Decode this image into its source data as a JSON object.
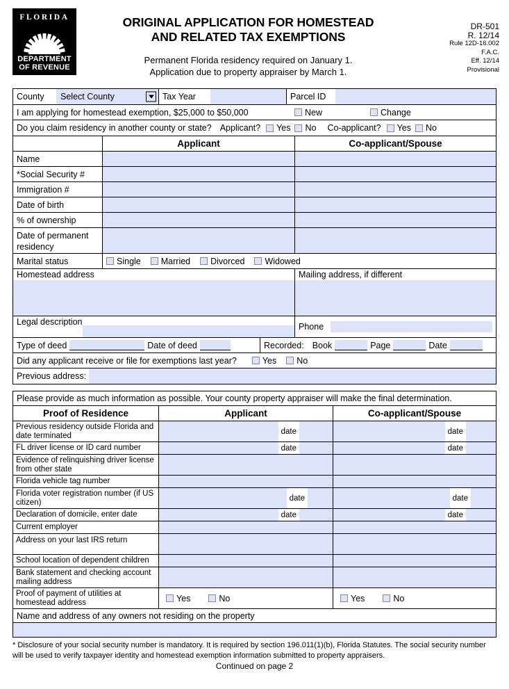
{
  "header": {
    "logo": {
      "top_text": "FLORIDA",
      "bottom_line1": "DEPARTMENT",
      "bottom_line2": "OF REVENUE"
    },
    "title_line1": "ORIGINAL APPLICATION FOR HOMESTEAD",
    "title_line2": "AND RELATED TAX EXEMPTIONS",
    "subtitle_line1": "Permanent Florida residency required on January 1.",
    "subtitle_line2": "Application due to property appraiser by March 1.",
    "form_number": "DR-501",
    "revision": "R. 12/14",
    "rule": "Rule 12D-16.002",
    "fac": "F.A.C.",
    "effective": "Eff. 12/14",
    "provisional": "Provisional"
  },
  "top": {
    "county_label": "County",
    "county_value": "Select County",
    "tax_year_label": "Tax Year",
    "tax_year_value": "",
    "parcel_id_label": "Parcel ID",
    "parcel_id_value": "",
    "exemption_text": "I am applying for homestead exemption, $25,000 to $50,000",
    "new_label": "New",
    "change_label": "Change",
    "residency_question": "Do you claim residency in another county or state?",
    "applicant_label": "Applicant?",
    "coapplicant_label": "Co-applicant?",
    "yes_label": "Yes",
    "no_label": "No"
  },
  "applicant_table": {
    "col_applicant": "Applicant",
    "col_coapplicant": "Co-applicant/Spouse",
    "rows": [
      {
        "label": "Name",
        "applicant": "",
        "coapplicant": ""
      },
      {
        "label": "*Social Security #",
        "applicant": "",
        "coapplicant": ""
      },
      {
        "label": "Immigration #",
        "applicant": "",
        "coapplicant": ""
      },
      {
        "label": "Date of birth",
        "applicant": "",
        "coapplicant": ""
      },
      {
        "label": "% of ownership",
        "applicant": "",
        "coapplicant": ""
      },
      {
        "label": "Date of permanent residency",
        "applicant": "",
        "coapplicant": ""
      }
    ],
    "marital_label": "Marital status",
    "marital_options": [
      "Single",
      "Married",
      "Divorced",
      "Widowed"
    ]
  },
  "address": {
    "homestead_label": "Homestead address",
    "homestead_value": "",
    "mailing_label": "Mailing address, if different",
    "mailing_value": "",
    "legal_label": "Legal description",
    "legal_value": "",
    "phone_label": "Phone",
    "phone_value": "",
    "type_of_deed_label": "Type of deed",
    "type_of_deed_value": "",
    "date_of_deed_label": "Date of deed",
    "date_of_deed_value": "",
    "recorded_label": "Recorded:",
    "book_label": "Book",
    "book_value": "",
    "page_label": "Page",
    "page_value": "",
    "date_label": "Date",
    "date_value": "",
    "exemptions_question": "Did any applicant receive or file for exemptions last year?",
    "yes_label": "Yes",
    "no_label": "No",
    "previous_address_label": "Previous address:",
    "previous_address_value": ""
  },
  "proof": {
    "note": "Please provide as much information as possible. Your county property appraiser will make the final determination.",
    "col_title": "Proof of Residence",
    "col_applicant": "Applicant",
    "col_coapplicant": "Co-applicant/Spouse",
    "date_label": "date",
    "yes_label": "Yes",
    "no_label": "No",
    "rows": [
      {
        "label": "Previous residency outside Florida and date terminated",
        "kind": "date",
        "applicant": "",
        "coapplicant": "",
        "applicant_date": "",
        "coapplicant_date": ""
      },
      {
        "label": "FL driver license or ID card number",
        "kind": "date",
        "applicant": "",
        "coapplicant": "",
        "applicant_date": "",
        "coapplicant_date": ""
      },
      {
        "label": "Evidence of relinquishing driver license from other state",
        "kind": "plain",
        "applicant": "",
        "coapplicant": ""
      },
      {
        "label": "Florida vehicle tag number",
        "kind": "plain",
        "applicant": "",
        "coapplicant": ""
      },
      {
        "label": "Florida voter registration number (if US citizen)",
        "kind": "date",
        "applicant": "",
        "coapplicant": "",
        "applicant_date": "",
        "coapplicant_date": ""
      },
      {
        "label": "Declaration of domicile, enter date",
        "kind": "date",
        "applicant": "",
        "coapplicant": "",
        "applicant_date": "",
        "coapplicant_date": ""
      },
      {
        "label": "Current employer",
        "kind": "plain",
        "applicant": "",
        "coapplicant": ""
      },
      {
        "label": "Address on your last IRS return",
        "kind": "plain",
        "applicant": "",
        "coapplicant": ""
      },
      {
        "label": "School location of dependent children",
        "kind": "plain",
        "applicant": "",
        "coapplicant": ""
      },
      {
        "label": "Bank statement and checking account mailing address",
        "kind": "plain",
        "applicant": "",
        "coapplicant": ""
      },
      {
        "label": "Proof of payment of utilities at homestead address",
        "kind": "yesno",
        "applicant": "",
        "coapplicant": ""
      }
    ],
    "owners_label": "Name and address of any owners not residing on the property",
    "owners_value": ""
  },
  "footer": {
    "disclosure": "* Disclosure of your social security number is mandatory. It is required by section 196.011(1)(b), Florida Statutes. The social security number will be used to verify taxpayer identity and homestead exemption information submitted to property appraisers.",
    "continued": "Continued on page 2"
  },
  "colors": {
    "field_fill": "#dde3f8",
    "border": "#000000",
    "checkbox_border": "#8a8a8a"
  }
}
